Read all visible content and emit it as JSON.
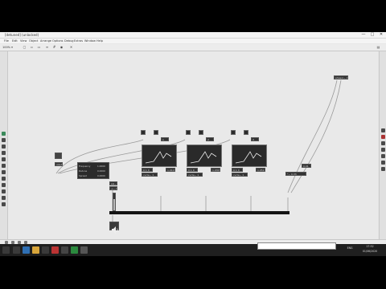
{
  "window": {
    "title": "[detuned] (unlocked)",
    "controls": [
      "—",
      "□",
      "✕"
    ]
  },
  "menus": [
    "File",
    "Edit",
    "View",
    "Object",
    "Arrange",
    "Options",
    "Debug",
    "Extras",
    "Window",
    "Help"
  ],
  "toolbar": {
    "zoom": "100% ▾"
  },
  "patch": {
    "objects": {
      "top_right": "phasor~ 0",
      "mtof": "mtof",
      "sig_in": "sig~",
      "gain": "gain~",
      "dac": "dac~",
      "plus": "+~ 0",
      "msg": "0.01",
      "sum": "*~ 0.33",
      "o1a": "0 1 0",
      "o1b": "cycle~ 1",
      "o2a": "0 1 0",
      "o2b": "cycle~ 1",
      "o3a": "0 1 0",
      "o3b": "cycle~ 1",
      "num1": "1",
      "num2": "2",
      "num3": "3",
      "scope1": "1.0102",
      "scope2": "1.0305",
      "scope3": "1.0512"
    },
    "params": [
      {
        "label": "Frequency",
        "value": "1.0000"
      },
      {
        "label": "Detune",
        "value": "0.0000"
      },
      {
        "label": "Spread",
        "value": "0.0000"
      }
    ]
  },
  "taskbar": {
    "search_placeholder": "",
    "clock_time": "17:32",
    "clock_date": "01/06/2020",
    "language": "ENG"
  },
  "colors": {
    "canvas_bg": "#e9e9e9",
    "object_bg": "#333333",
    "taskbar_bg": "#1f1f1f",
    "wire": "#9a9a9a"
  }
}
